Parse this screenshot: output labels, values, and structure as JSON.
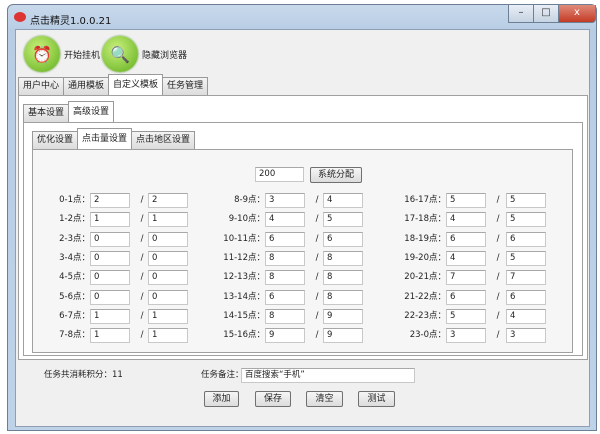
{
  "window": {
    "title": "点击精灵1.0.0.21",
    "minimize": "–",
    "maximize": "□",
    "close": "x"
  },
  "toolbar": {
    "start": "开始挂机",
    "hide_browser": "隐藏浏览器"
  },
  "main_tabs": [
    "用户中心",
    "通用模板",
    "自定义模板",
    "任务管理"
  ],
  "sub_tabs": [
    "基本设置",
    "高级设置"
  ],
  "inner_tabs": [
    "优化设置",
    "点击量设置",
    "点击地区设置"
  ],
  "total": {
    "value": "200",
    "button": "系统分配"
  },
  "hours": [
    [
      "0-1点：",
      "2",
      "2"
    ],
    [
      "1-2点：",
      "1",
      "1"
    ],
    [
      "2-3点：",
      "0",
      "0"
    ],
    [
      "3-4点：",
      "0",
      "0"
    ],
    [
      "4-5点：",
      "0",
      "0"
    ],
    [
      "5-6点：",
      "0",
      "0"
    ],
    [
      "6-7点：",
      "1",
      "1"
    ],
    [
      "7-8点：",
      "1",
      "1"
    ],
    [
      "8-9点：",
      "3",
      "4"
    ],
    [
      "9-10点：",
      "4",
      "5"
    ],
    [
      "10-11点：",
      "6",
      "6"
    ],
    [
      "11-12点：",
      "8",
      "8"
    ],
    [
      "12-13点：",
      "8",
      "8"
    ],
    [
      "13-14点：",
      "6",
      "8"
    ],
    [
      "14-15点：",
      "8",
      "9"
    ],
    [
      "15-16点：",
      "9",
      "9"
    ],
    [
      "16-17点：",
      "5",
      "5"
    ],
    [
      "17-18点：",
      "4",
      "5"
    ],
    [
      "18-19点：",
      "6",
      "6"
    ],
    [
      "19-20点：",
      "4",
      "5"
    ],
    [
      "20-21点：",
      "7",
      "7"
    ],
    [
      "21-22点：",
      "6",
      "6"
    ],
    [
      "22-23点：",
      "5",
      "4"
    ],
    [
      "23-0点：",
      "3",
      "3"
    ]
  ],
  "slash": "/",
  "footer": {
    "points_label": "任务共消耗积分：",
    "points": "11",
    "note_label": "任务备注：",
    "note": "百度搜索“手机”",
    "add": "添加",
    "save": "保存",
    "clear": "清空",
    "test": "测试"
  }
}
